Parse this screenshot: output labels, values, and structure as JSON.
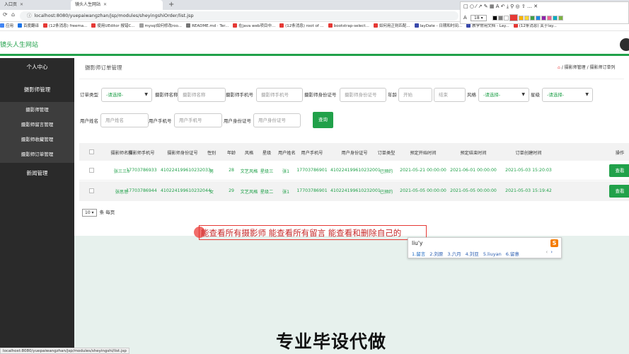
{
  "browser": {
    "tabs": [
      {
        "label": "入口页"
      },
      {
        "label": "镜头人生网站"
      }
    ],
    "url": "localhost:8080/yuepaiwangzhan/jsp/modules/sheyingshiOrder/list.jsp",
    "bookmarks": [
      "应用",
      "百度翻译",
      "(12条消息) freema...",
      "使用UEditor 报错C...",
      "mysql如何修改roo...",
      "README.md · Ter...",
      "在java web项目中...",
      "(12条消息) root of ...",
      "bootstrap-select...",
      "如何用正则匹配...",
      "layDate - 日期和时间...",
      "教学常用文档 - Lay...",
      "(12条消息) 关于lay..."
    ],
    "status_url": "localhost:8080/yuepaiwangzhan/jsp/modules/sheyingshi/list.jsp"
  },
  "annotation_toolbar": {
    "font_label": "A",
    "font_size": "18",
    "colors": [
      "#000000",
      "#808080",
      "#ffffff",
      "#e53935",
      "#ffb300",
      "#fdd835",
      "#43a047",
      "#1e88e5",
      "#8e24aa",
      "#f06292",
      "#00acc1",
      "#7cb342"
    ],
    "active_color": "#e53935"
  },
  "site": {
    "title": "镜头人生网站",
    "accent": "#21a14a"
  },
  "sidebar": {
    "items": [
      {
        "label": "个人中心"
      },
      {
        "label": "摄影师管理"
      },
      {
        "label": "摄影师管理"
      },
      {
        "label": "摄影师留言管理"
      },
      {
        "label": "摄影师收藏管理"
      },
      {
        "label": "摄影师订单管理"
      },
      {
        "label": "新闻管理"
      }
    ]
  },
  "page": {
    "title": "摄影师订单管理",
    "breadcrumb": "摄影师管理 / 摄影师订单列",
    "home_icon": "home-icon"
  },
  "filters": {
    "order_type_label": "订单类型",
    "order_type_value": "-请选择-",
    "name_label": "摄影师名称",
    "name_placeholder": "摄影师名称",
    "phone_label": "摄影师手机号",
    "phone_placeholder": "摄影师手机号",
    "id_label": "摄影师身份证号",
    "id_placeholder": "摄影师身份证号",
    "age_label": "年龄",
    "age_start_placeholder": "开始",
    "age_end_placeholder": "结束",
    "style_label": "风格",
    "style_value": "-请选择-",
    "level_label": "星级",
    "level_value": "-请选择-",
    "user_name_label": "用户姓名",
    "user_name_placeholder": "用户姓名",
    "user_phone_label": "用户手机号",
    "user_phone_placeholder": "用户手机号",
    "user_id_label": "用户身份证号",
    "user_id_placeholder": "用户身份证号",
    "search_button": "查询"
  },
  "table": {
    "columns": [
      "摄影师名称",
      "摄影师手机号",
      "摄影师身份证号",
      "性别",
      "年龄",
      "风格",
      "星级",
      "用户姓名",
      "用户手机号",
      "用户身份证号",
      "订单类型",
      "预定开始时间",
      "预定结束时间",
      "订单创建时间",
      "操作"
    ],
    "rows": [
      [
        "张三三3",
        "17703786933",
        "410224199610232033",
        "男",
        "28",
        "文艺风格",
        "星级三",
        "张1",
        "17703786901",
        "410224199610232001",
        "已预约",
        "2021-05-21 00:00:00",
        "2021-06-01 00:00:00",
        "2021-05-03 15:20:03",
        "查看"
      ],
      [
        "张思思",
        "17703786944",
        "410224199610232044",
        "女",
        "29",
        "文艺风格",
        "星级二",
        "张1",
        "17703786901",
        "410224199610232001",
        "已预约",
        "2021-05-05 00:00:00",
        "2021-05-05 00:00:00",
        "2021-05-03 15:19:42",
        "查看"
      ]
    ]
  },
  "pager": {
    "page_size": "10",
    "suffix": "条 每页"
  },
  "ime": {
    "typed_text": "能查看所有摄影师 能查看所有留言  能查看和删除自己的",
    "input": "liu'y",
    "candidates": [
      "1.留言",
      "2.刘原",
      "3.六月",
      "4.刘亚",
      "5.liuyan",
      "6.留意"
    ],
    "logo": "S"
  },
  "promo": {
    "text": "专业毕设代做"
  }
}
